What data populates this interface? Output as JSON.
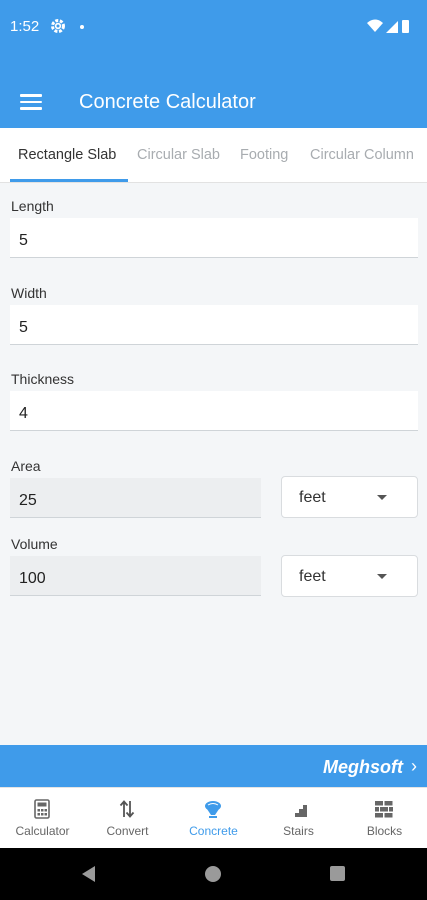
{
  "status_bar": {
    "time": "1:52",
    "icons": [
      "gear-icon",
      "dot",
      "wifi-icon",
      "signal-icon",
      "battery-icon"
    ]
  },
  "app_bar": {
    "title": "Concrete Calculator",
    "menu_icon": "hamburger-menu-icon"
  },
  "tabs": [
    {
      "label": "Rectangle Slab",
      "active": true
    },
    {
      "label": "Circular Slab",
      "active": false
    },
    {
      "label": "Footing",
      "active": false
    },
    {
      "label": "Circular Column",
      "active": false
    }
  ],
  "form": {
    "length": {
      "label": "Length",
      "value": "5"
    },
    "width": {
      "label": "Width",
      "value": "5"
    },
    "thickness": {
      "label": "Thickness",
      "value": "4"
    },
    "area": {
      "label": "Area",
      "value": "25",
      "unit": "feet"
    },
    "volume": {
      "label": "Volume",
      "value": "100",
      "unit": "feet"
    }
  },
  "banner": {
    "brand": "Meghsoft",
    "chevron": "›"
  },
  "bottom_nav": [
    {
      "label": "Calculator",
      "icon": "calculator-icon",
      "active": false
    },
    {
      "label": "Convert",
      "icon": "convert-arrows-icon",
      "active": false
    },
    {
      "label": "Concrete",
      "icon": "concrete-mixer-icon",
      "active": true
    },
    {
      "label": "Stairs",
      "icon": "stairs-icon",
      "active": false
    },
    {
      "label": "Blocks",
      "icon": "blocks-icon",
      "active": false
    }
  ],
  "colors": {
    "primary": "#3f9bea",
    "background": "#f4f6f8",
    "inactive_tab": "#a8acb0"
  }
}
